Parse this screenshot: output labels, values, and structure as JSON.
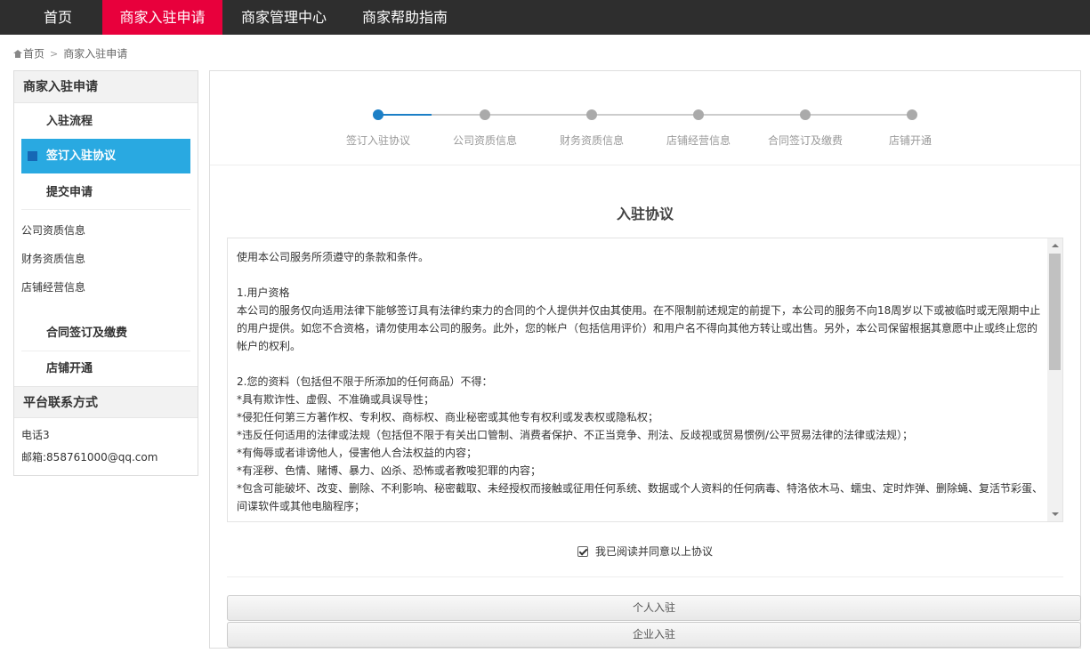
{
  "nav": {
    "items": [
      {
        "label": "首页"
      },
      {
        "label": "商家入驻申请"
      },
      {
        "label": "商家管理中心"
      },
      {
        "label": "商家帮助指南"
      }
    ],
    "active_index": 1,
    "active_color": "#e8003c"
  },
  "breadcrumb": {
    "home": "首页",
    "current": "商家入驻申请"
  },
  "sidebar": {
    "section_title": "商家入驻申请",
    "steps": [
      {
        "label": "入驻流程"
      },
      {
        "label": "签订入驻协议"
      },
      {
        "label": "提交申请"
      }
    ],
    "active_step": 1,
    "active_color": "#29a9e1",
    "plain_items": [
      "公司资质信息",
      "财务资质信息",
      "店铺经营信息"
    ],
    "steps2": [
      {
        "label": "合同签订及缴费"
      },
      {
        "label": "店铺开通"
      }
    ],
    "contact_title": "平台联系方式",
    "phone": "电话3",
    "email": "邮箱:858761000@qq.com"
  },
  "progress": {
    "steps": [
      "签订入驻协议",
      "公司资质信息",
      "财务资质信息",
      "店铺经营信息",
      "合同签订及缴费",
      "店铺开通"
    ],
    "current": 1,
    "active_color": "#1c7fc6"
  },
  "agreement": {
    "title": "入驻协议",
    "paragraphs": [
      "使用本公司服务所须遵守的条款和条件。",
      "",
      "1.用户资格",
      "本公司的服务仅向适用法律下能够签订具有法律约束力的合同的个人提供并仅由其使用。在不限制前述规定的前提下，本公司的服务不向18周岁以下或被临时或无限期中止的用户提供。如您不合资格，请勿使用本公司的服务。此外，您的帐户（包括信用评价）和用户名不得向其他方转让或出售。另外，本公司保留根据其意愿中止或终止您的帐户的权利。",
      "",
      "2.您的资料（包括但不限于所添加的任何商品）不得：",
      "*具有欺诈性、虚假、不准确或具误导性；",
      "*侵犯任何第三方著作权、专利权、商标权、商业秘密或其他专有权利或发表权或隐私权；",
      "*违反任何适用的法律或法规（包括但不限于有关出口管制、消费者保护、不正当竞争、刑法、反歧视或贸易惯例/公平贸易法律的法律或法规）；",
      "*有侮辱或者诽谤他人，侵害他人合法权益的内容；",
      "*有淫秽、色情、赌博、暴力、凶杀、恐怖或者教唆犯罪的内容；",
      "*包含可能破坏、改变、删除、不利影响、秘密截取、未经授权而接触或征用任何系统、数据或个人资料的任何病毒、特洛依木马、蠕虫、定时炸弹、删除蝇、复活节彩蛋、间谍软件或其他电脑程序；"
    ],
    "agree_label": "我已阅读并同意以上协议",
    "agree_checked": true
  },
  "buttons": {
    "personal": "个人入驻",
    "enterprise": "企业入驻"
  }
}
